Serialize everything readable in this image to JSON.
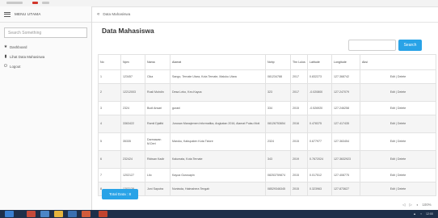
{
  "sidebar": {
    "menu_title": "MENU UTAMA",
    "search_placeholder": "Search Something",
    "items": [
      {
        "label": "Dashboard",
        "icon": "star-icon"
      },
      {
        "label": "Lihat Data Mahasiswa",
        "icon": "document-icon"
      },
      {
        "label": "Logout",
        "icon": "power-icon"
      }
    ]
  },
  "breadcrumb": {
    "label": "Data Mahasiswa"
  },
  "main": {
    "title": "Data Mahasiswa",
    "search_button": "Search",
    "total_label": "Total Data : 8"
  },
  "table": {
    "headers": [
      "No",
      "Npm",
      "Nama",
      "Alamat",
      "Nohp",
      "Thn Lulus",
      "Latitude",
      "Longitude",
      "Aksi"
    ],
    "rows": [
      {
        "no": "1",
        "npm": "123457",
        "nama": "Cika",
        "alamat": "Sango, Ternate Utara, Kota Ternate, Maluku Utara",
        "nohp": "081234788",
        "thn": "2017",
        "lat": "0.832273",
        "lng": "127.368742",
        "aksi": "Edit | Delete"
      },
      {
        "no": "2",
        "npm": "12212003",
        "nama": "Rusli Muhdin",
        "alamat": "Desa Leko, Kec.Kayoa",
        "nohp": "323",
        "thn": "2017",
        "lat": "-0.020800",
        "lng": "127.247079",
        "aksi": "Edit | Delete"
      },
      {
        "no": "3",
        "npm": "2324",
        "nama": "Budi Ansari",
        "alamat": "gurani",
        "nohp": "334",
        "thn": "2015",
        "lat": "-0.526920",
        "lng": "127.246258",
        "aksi": "Edit | Delete"
      },
      {
        "no": "4",
        "npm": "3363422",
        "nama": "Ramli Djalfid",
        "alamat": "Jurusan Manajemen Informatika, Angkatan 2016, Alamat Pulau Moti",
        "nohp": "08126753654",
        "thn": "2016",
        "lat": "0.478375",
        "lng": "127.417435",
        "aksi": "Edit | Delete"
      },
      {
        "no": "5",
        "npm": "35335",
        "nama": "Darmawan M.Deri",
        "alamat": "Maroku, Kabupaten Kota Tidore",
        "nohp": "2324",
        "thn": "2015",
        "lat": "0.677977",
        "lng": "127.363454",
        "aksi": "Edit | Delete"
      },
      {
        "no": "6",
        "npm": "232424",
        "nama": "Ridwan Kadir",
        "alamat": "Kalumata, Kota Ternate",
        "nohp": "343",
        "thn": "2019",
        "lat": "0.7672024",
        "lng": "127.3632923",
        "aksi": "Edit | Delete"
      },
      {
        "no": "7",
        "npm": "1202127",
        "nama": "Lilo",
        "alamat": "Kayoa Gurusapin",
        "nohp": "08253759874",
        "thn": "2015",
        "lat": "0.017512",
        "lng": "127.408775",
        "aksi": "Edit | Delete"
      },
      {
        "no": "8",
        "npm": "1202128",
        "nama": "Joni Saputra",
        "alamat": "Nuniwda, Halmahera Tengah",
        "nohp": "08529346345",
        "thn": "2015",
        "lat": "0.323963",
        "lng": "127.873627",
        "aksi": "Edit | Delete"
      }
    ]
  },
  "status_bar": {
    "zoom": "100%"
  },
  "taskbar": {
    "time": "12:00"
  },
  "colors": {
    "accent": "#29a3e7",
    "link": "#2a8bd4",
    "taskbar": "#1e2f49"
  }
}
